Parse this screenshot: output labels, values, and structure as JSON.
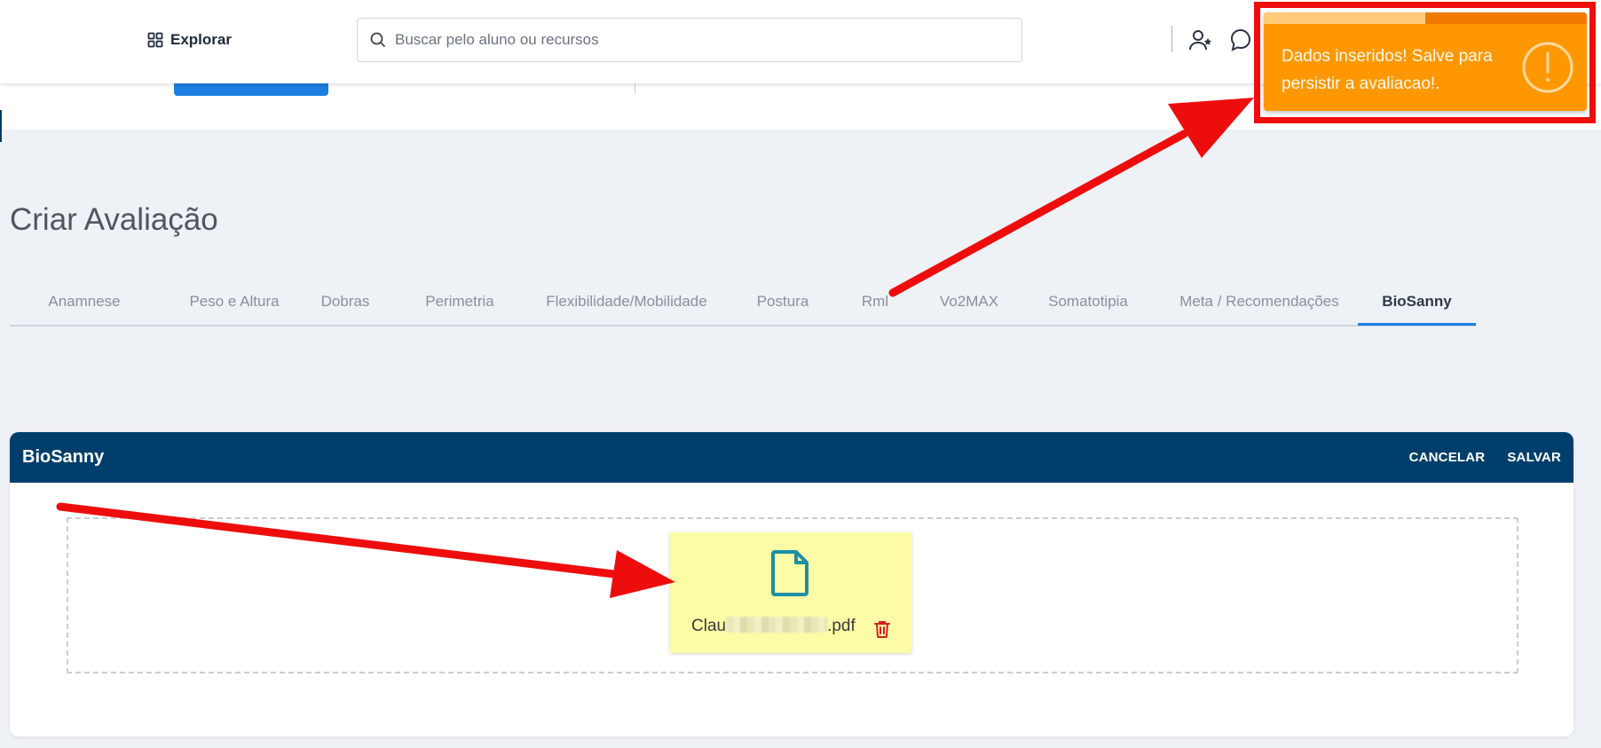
{
  "header": {
    "explore_label": "Explorar",
    "search_placeholder": "Buscar pelo aluno ou recursos"
  },
  "page": {
    "title": "Criar Avaliação"
  },
  "tabs": [
    {
      "label": "Anamnese"
    },
    {
      "label": "Peso e Altura"
    },
    {
      "label": "Dobras"
    },
    {
      "label": "Perimetria"
    },
    {
      "label": "Flexibilidade/Mobilidade"
    },
    {
      "label": "Postura"
    },
    {
      "label": "Rml"
    },
    {
      "label": "Vo2MAX"
    },
    {
      "label": "Somatotipia"
    },
    {
      "label": "Meta / Recomendações"
    },
    {
      "label": "BioSanny",
      "active": true
    }
  ],
  "card": {
    "title": "BioSanny",
    "cancel_label": "CANCELAR",
    "save_label": "SALVAR"
  },
  "file": {
    "name_prefix": "Clau",
    "name_suffix": ".pdf"
  },
  "toast": {
    "message": "Dados inseridos! Salve para persistir a avaliacao!.",
    "progress": 0.5
  },
  "colors": {
    "header_bg": "#ffffff",
    "page_bg": "#eef1f6",
    "card_header": "#003f6b",
    "accent_blue": "#1a7fe0",
    "toast_bg": "#ff9800",
    "annotation_red": "#ee0d0d",
    "file_tile_bg": "#fdfca6",
    "icon_teal": "#1d8fa6",
    "trash_red": "#d62020"
  },
  "icons": {
    "explore": "grid-icon",
    "search": "search-icon",
    "user_add": "user-star-icon",
    "chat": "chat-icon",
    "file": "document-icon",
    "delete": "trash-icon",
    "toast": "exclamation-circle-icon"
  }
}
